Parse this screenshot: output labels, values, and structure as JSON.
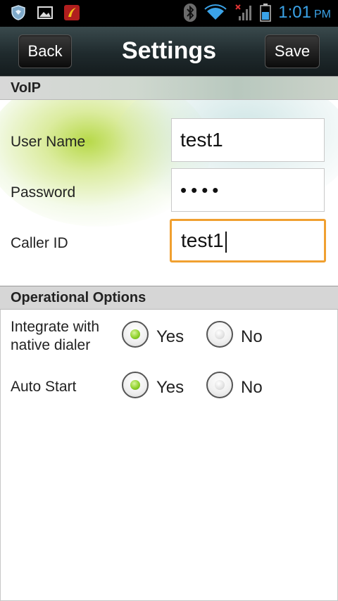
{
  "status_bar": {
    "time": "1:01",
    "ampm": "PM",
    "icons_left": [
      "shield-icon",
      "image-icon",
      "app-icon"
    ],
    "icons_right": [
      "bluetooth-icon",
      "wifi-icon",
      "signal-icon",
      "battery-icon"
    ]
  },
  "titlebar": {
    "title": "Settings",
    "back_label": "Back",
    "save_label": "Save"
  },
  "voip": {
    "header": "VoIP",
    "fields": {
      "user_name": {
        "label": "User Name",
        "value": "test1"
      },
      "password": {
        "label": "Password",
        "value": "••••"
      },
      "caller_id": {
        "label": "Caller ID",
        "value": "test1"
      }
    }
  },
  "options": {
    "header": "Operational Options",
    "integrate": {
      "label_line1": "Integrate with",
      "label_line2": "native dialer",
      "yes": "Yes",
      "no": "No",
      "selected": "Yes"
    },
    "auto_start": {
      "label": "Auto Start",
      "yes": "Yes",
      "no": "No",
      "selected": "Yes"
    }
  },
  "colors": {
    "clock": "#3ba3e8",
    "focus_border": "#f0a030",
    "radio_selected": "#8fd12b"
  }
}
